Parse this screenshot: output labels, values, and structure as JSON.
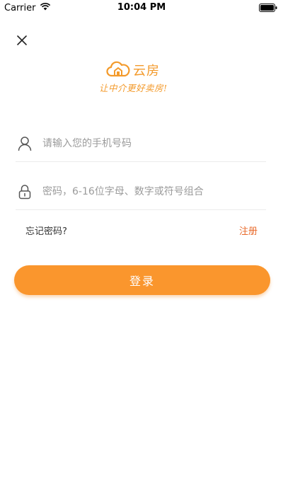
{
  "status_bar": {
    "carrier": "Carrier",
    "time": "10:04 PM"
  },
  "icons": {
    "close": "close-icon",
    "user": "user-icon",
    "lock": "lock-icon",
    "logo": "cloud-house-icon",
    "wifi": "wifi-icon",
    "battery": "battery-icon"
  },
  "logo": {
    "name": "云房",
    "slogan": "让中介更好卖房!"
  },
  "form": {
    "phone_placeholder": "请输入您的手机号码",
    "password_placeholder": "密码，6-16位字母、数字或符号组合",
    "forgot_label": "忘记密码?",
    "register_label": "注册",
    "login_label": "登录"
  },
  "colors": {
    "accent": "#fa962d",
    "register": "#e8692a",
    "logo": "#f39a2b"
  }
}
